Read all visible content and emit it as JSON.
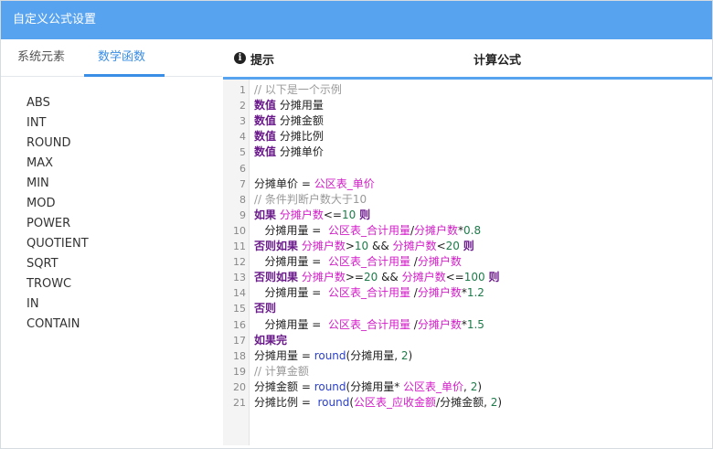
{
  "window": {
    "title": "自定义公式设置"
  },
  "tabs": [
    {
      "label": "系统元素"
    },
    {
      "label": "数学函数",
      "active": true
    }
  ],
  "functions": [
    "ABS",
    "INT",
    "ROUND",
    "MAX",
    "MIN",
    "MOD",
    "POWER",
    "QUOTIENT",
    "SQRT",
    "TROWC",
    "IN",
    "CONTAIN"
  ],
  "panel": {
    "hint_label": "提示",
    "formula_title": "计算公式"
  },
  "editor": {
    "line_numbers": [
      "1",
      "2",
      "3",
      "4",
      "5",
      "6",
      "7",
      "8",
      "9",
      "10",
      "11",
      "12",
      "13",
      "14",
      "15",
      "16",
      "17",
      "18",
      "19",
      "20",
      "21"
    ],
    "lines": [
      [
        {
          "t": "// 以下是一个示例",
          "c": "cm"
        }
      ],
      [
        {
          "t": "数值",
          "c": "kw"
        },
        {
          "t": " 分摊用量",
          "c": ""
        }
      ],
      [
        {
          "t": "数值",
          "c": "kw"
        },
        {
          "t": " 分摊金额",
          "c": ""
        }
      ],
      [
        {
          "t": "数值",
          "c": "kw"
        },
        {
          "t": " 分摊比例",
          "c": ""
        }
      ],
      [
        {
          "t": "数值",
          "c": "kw"
        },
        {
          "t": " 分摊单价",
          "c": ""
        }
      ],
      [],
      [
        {
          "t": "分摊单价 = ",
          "c": ""
        },
        {
          "t": "公区表_单价",
          "c": "rf"
        }
      ],
      [
        {
          "t": "// 条件判断户数大于10",
          "c": "cm"
        }
      ],
      [
        {
          "t": "如果",
          "c": "kw"
        },
        {
          "t": " ",
          "c": ""
        },
        {
          "t": "分摊户数",
          "c": "rf"
        },
        {
          "t": "<=",
          "c": ""
        },
        {
          "t": "10",
          "c": "num"
        },
        {
          "t": " ",
          "c": ""
        },
        {
          "t": "则",
          "c": "kw"
        }
      ],
      [
        {
          "t": "   分摊用量 =  ",
          "c": ""
        },
        {
          "t": "公区表_合计用量",
          "c": "rf"
        },
        {
          "t": "/",
          "c": ""
        },
        {
          "t": "分摊户数",
          "c": "rf"
        },
        {
          "t": "*",
          "c": ""
        },
        {
          "t": "0.8",
          "c": "num"
        }
      ],
      [
        {
          "t": "否则如果",
          "c": "kw"
        },
        {
          "t": " ",
          "c": ""
        },
        {
          "t": "分摊户数",
          "c": "rf"
        },
        {
          "t": ">",
          "c": ""
        },
        {
          "t": "10",
          "c": "num"
        },
        {
          "t": " && ",
          "c": ""
        },
        {
          "t": "分摊户数",
          "c": "rf"
        },
        {
          "t": "<",
          "c": ""
        },
        {
          "t": "20",
          "c": "num"
        },
        {
          "t": " ",
          "c": ""
        },
        {
          "t": "则",
          "c": "kw"
        }
      ],
      [
        {
          "t": "   分摊用量 =  ",
          "c": ""
        },
        {
          "t": "公区表_合计用量",
          "c": "rf"
        },
        {
          "t": " /",
          "c": ""
        },
        {
          "t": "分摊户数",
          "c": "rf"
        }
      ],
      [
        {
          "t": "否则如果",
          "c": "kw"
        },
        {
          "t": " ",
          "c": ""
        },
        {
          "t": "分摊户数",
          "c": "rf"
        },
        {
          "t": ">=",
          "c": ""
        },
        {
          "t": "20",
          "c": "num"
        },
        {
          "t": " && ",
          "c": ""
        },
        {
          "t": "分摊户数",
          "c": "rf"
        },
        {
          "t": "<=",
          "c": ""
        },
        {
          "t": "100",
          "c": "num"
        },
        {
          "t": " ",
          "c": ""
        },
        {
          "t": "则",
          "c": "kw"
        }
      ],
      [
        {
          "t": "   分摊用量 =  ",
          "c": ""
        },
        {
          "t": "公区表_合计用量",
          "c": "rf"
        },
        {
          "t": " /",
          "c": ""
        },
        {
          "t": "分摊户数",
          "c": "rf"
        },
        {
          "t": "*",
          "c": ""
        },
        {
          "t": "1.2",
          "c": "num"
        }
      ],
      [
        {
          "t": "否则",
          "c": "kw"
        }
      ],
      [
        {
          "t": "   分摊用量 =  ",
          "c": ""
        },
        {
          "t": "公区表_合计用量",
          "c": "rf"
        },
        {
          "t": " /",
          "c": ""
        },
        {
          "t": "分摊户数",
          "c": "rf"
        },
        {
          "t": "*",
          "c": ""
        },
        {
          "t": "1.5",
          "c": "num"
        }
      ],
      [
        {
          "t": "如果完",
          "c": "kw"
        }
      ],
      [
        {
          "t": "分摊用量 = ",
          "c": ""
        },
        {
          "t": "round",
          "c": "fn"
        },
        {
          "t": "(分摊用量, ",
          "c": ""
        },
        {
          "t": "2",
          "c": "num"
        },
        {
          "t": ")",
          "c": ""
        }
      ],
      [
        {
          "t": "// 计算金额",
          "c": "cm"
        }
      ],
      [
        {
          "t": "分摊金额 = ",
          "c": ""
        },
        {
          "t": "round",
          "c": "fn"
        },
        {
          "t": "(分摊用量* ",
          "c": ""
        },
        {
          "t": "公区表_单价",
          "c": "rf"
        },
        {
          "t": ", ",
          "c": ""
        },
        {
          "t": "2",
          "c": "num"
        },
        {
          "t": ")",
          "c": ""
        }
      ],
      [
        {
          "t": "分摊比例 =  ",
          "c": ""
        },
        {
          "t": "round",
          "c": "fn"
        },
        {
          "t": "(",
          "c": ""
        },
        {
          "t": "公区表_应收金额",
          "c": "rf"
        },
        {
          "t": "/分摊金额, ",
          "c": ""
        },
        {
          "t": "2",
          "c": "num"
        },
        {
          "t": ")",
          "c": ""
        }
      ]
    ]
  },
  "colors": {
    "titlebar": "#58a3f0",
    "accent": "#3a8ee6",
    "keyword": "#6a1a8a",
    "reference": "#d31cc8",
    "number": "#1e7a4a",
    "function": "#2b3fc8",
    "comment": "#999999"
  },
  "icons": {
    "hint": "info-circle-icon"
  }
}
